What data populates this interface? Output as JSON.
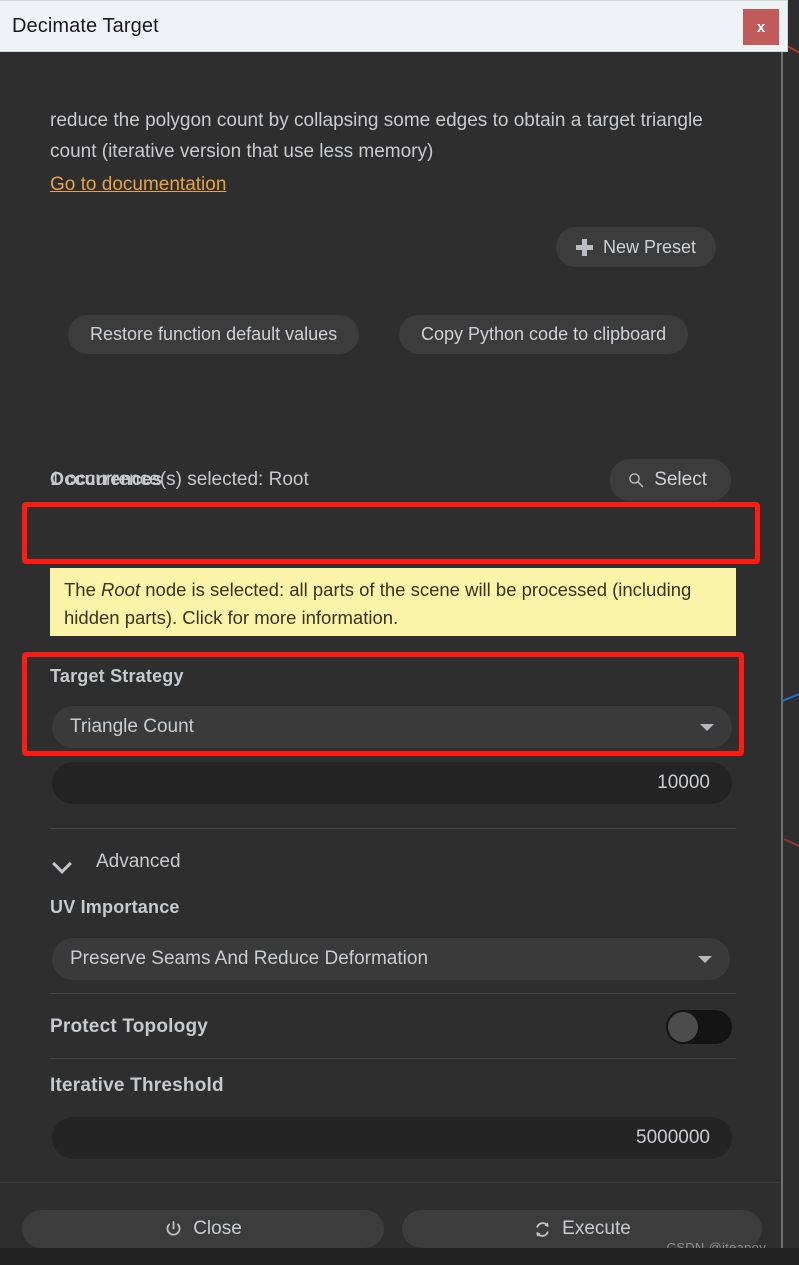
{
  "window": {
    "title": "Decimate Target",
    "close_label": "x",
    "close_icon": "close-icon"
  },
  "description": {
    "text": "reduce the polygon count by collapsing some edges to obtain a target triangle count (iterative version that use less memory)",
    "doc_link": "Go to documentation"
  },
  "preset": {
    "new_preset_label": "New Preset",
    "plus_icon": "plus-icon"
  },
  "actions": {
    "restore_defaults_label": "Restore function default values",
    "copy_python_label": "Copy Python code to clipboard"
  },
  "occurrences": {
    "label": "Occurrences",
    "selection_text": "1 occurrence(s) selected: Root",
    "select_button_label": "Select",
    "select_icon": "search-icon",
    "info_prefix": "The ",
    "info_emphasis": "Root",
    "info_suffix": " node is selected: all parts of the scene will be processed (including hidden parts). Click for more information."
  },
  "target_strategy": {
    "label": "Target Strategy",
    "value": "Triangle Count",
    "caret_icon": "chevron-down-icon",
    "count_value": "10000"
  },
  "advanced": {
    "label": "Advanced",
    "chevron_icon": "chevron-down-icon"
  },
  "uv_importance": {
    "label": "UV Importance",
    "value": "Preserve Seams And Reduce Deformation",
    "caret_icon": "chevron-down-icon"
  },
  "protect_topology": {
    "label": "Protect Topology",
    "state": "off"
  },
  "iterative_threshold": {
    "label": "Iterative Threshold",
    "value": "5000000"
  },
  "footer": {
    "close_label": "Close",
    "close_icon": "power-icon",
    "execute_label": "Execute",
    "execute_icon": "refresh-icon"
  },
  "watermark": {
    "text": "CSDN @iteapoy"
  },
  "colors": {
    "panel_bg": "#2e2e2e",
    "titlebar_bg": "#eef4f6",
    "close_red": "#c15b5b",
    "link_orange": "#e8a33d",
    "annotation_red": "#ff1a12",
    "info_yellow": "#faf3a8",
    "control_bg": "#3a3a3a",
    "field_bg": "#242424"
  }
}
